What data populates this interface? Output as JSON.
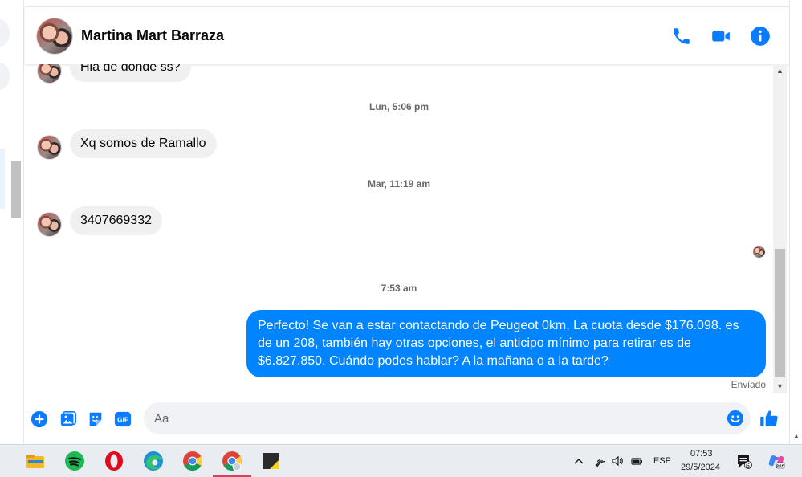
{
  "conversation": {
    "contact_name": "Martina Mart Barraza"
  },
  "messages": [
    {
      "type": "in",
      "text": "Hla de donde ss?"
    },
    {
      "type": "time",
      "text": "Lun, 5:06 pm"
    },
    {
      "type": "in",
      "text": "Xq somos de Ramallo"
    },
    {
      "type": "time",
      "text": "Mar, 11:19 am"
    },
    {
      "type": "in",
      "text": "3407669332"
    },
    {
      "type": "time",
      "text": "7:53 am"
    },
    {
      "type": "out",
      "text": "Perfecto!  Se van a estar contactando de Peugeot 0km, La cuota desde $176.098. es de un 208, también hay otras opciones, el anticipo mínimo para retirar es de $6.827.850. Cuándo podes hablar? A la mañana o a la tarde?"
    }
  ],
  "status": {
    "sent": "Enviado"
  },
  "composer": {
    "placeholder": "Aa"
  },
  "taskbar": {
    "apps": [
      "file-explorer",
      "spotify",
      "opera",
      "edge",
      "chrome",
      "chrome-profile",
      "sticky-notes"
    ],
    "language": "ESP",
    "time": "07:53",
    "date": "29/5/2024",
    "notification_count": "6"
  },
  "colors": {
    "accent": "#0084ff",
    "messenger_blue": "#0a7cff",
    "incoming_bubble": "#f0f0f0"
  }
}
